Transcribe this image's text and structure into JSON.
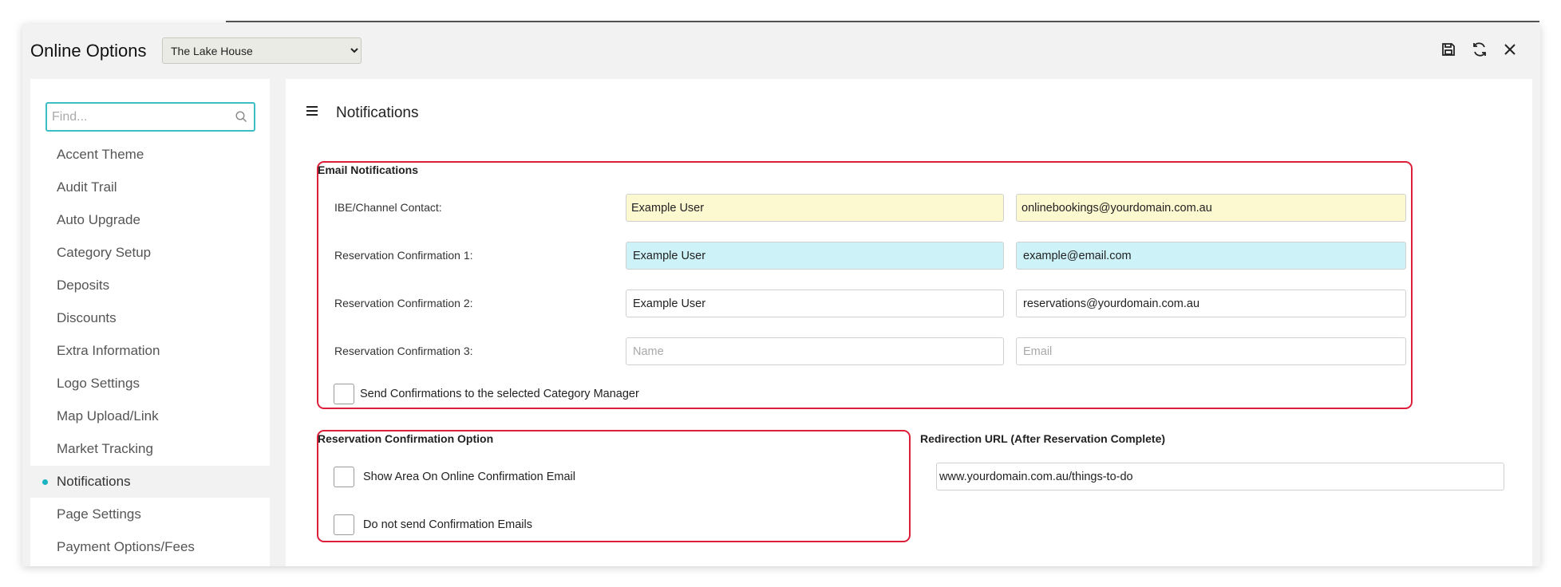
{
  "app": {
    "title": "Online Options",
    "property_select": {
      "selected": "The Lake House",
      "options": [
        "The Lake House"
      ]
    },
    "toolbar": {
      "save_icon": "save-icon",
      "refresh_icon": "refresh-icon",
      "close_icon": "close-icon"
    }
  },
  "sidebar": {
    "search_placeholder": "Find...",
    "items": [
      {
        "label": "Accent Theme"
      },
      {
        "label": "Audit Trail"
      },
      {
        "label": "Auto Upgrade"
      },
      {
        "label": "Category Setup"
      },
      {
        "label": "Deposits"
      },
      {
        "label": "Discounts"
      },
      {
        "label": "Extra Information"
      },
      {
        "label": "Logo Settings"
      },
      {
        "label": "Map Upload/Link"
      },
      {
        "label": "Market Tracking"
      },
      {
        "label": "Notifications",
        "active": true
      },
      {
        "label": "Page Settings"
      },
      {
        "label": "Payment Options/Fees"
      }
    ]
  },
  "main": {
    "heading": "Notifications",
    "email_notifications": {
      "title": "Email Notifications",
      "rows": [
        {
          "label": "IBE/Channel Contact:",
          "name": "Example User",
          "email": "onlinebookings@yourdomain.com.au"
        },
        {
          "label": "Reservation Confirmation 1:",
          "name": "Example User",
          "email": "example@email.com"
        },
        {
          "label": "Reservation Confirmation 2:",
          "name": "Example User",
          "email": "reservations@yourdomain.com.au"
        },
        {
          "label": "Reservation Confirmation 3:",
          "name": "",
          "email": ""
        }
      ],
      "name_placeholder": "Name",
      "email_placeholder": "Email",
      "category_manager_checkbox": {
        "label": "Send Confirmations to the selected Category Manager",
        "checked": false
      }
    },
    "confirmation_option": {
      "title": "Reservation Confirmation Option",
      "show_area": {
        "label": "Show Area On Online Confirmation Email",
        "checked": false
      },
      "do_not_send": {
        "label": "Do not send Confirmation Emails",
        "checked": false
      }
    },
    "redirection": {
      "title": "Redirection URL (After Reservation Complete)",
      "value": "www.yourdomain.com.au/things-to-do"
    }
  },
  "colors": {
    "accent": "#3dbdc6",
    "highlight_border": "#dd1f3a",
    "row_yellow": "#fcf8d0",
    "row_cyan": "#cdf2f7"
  }
}
